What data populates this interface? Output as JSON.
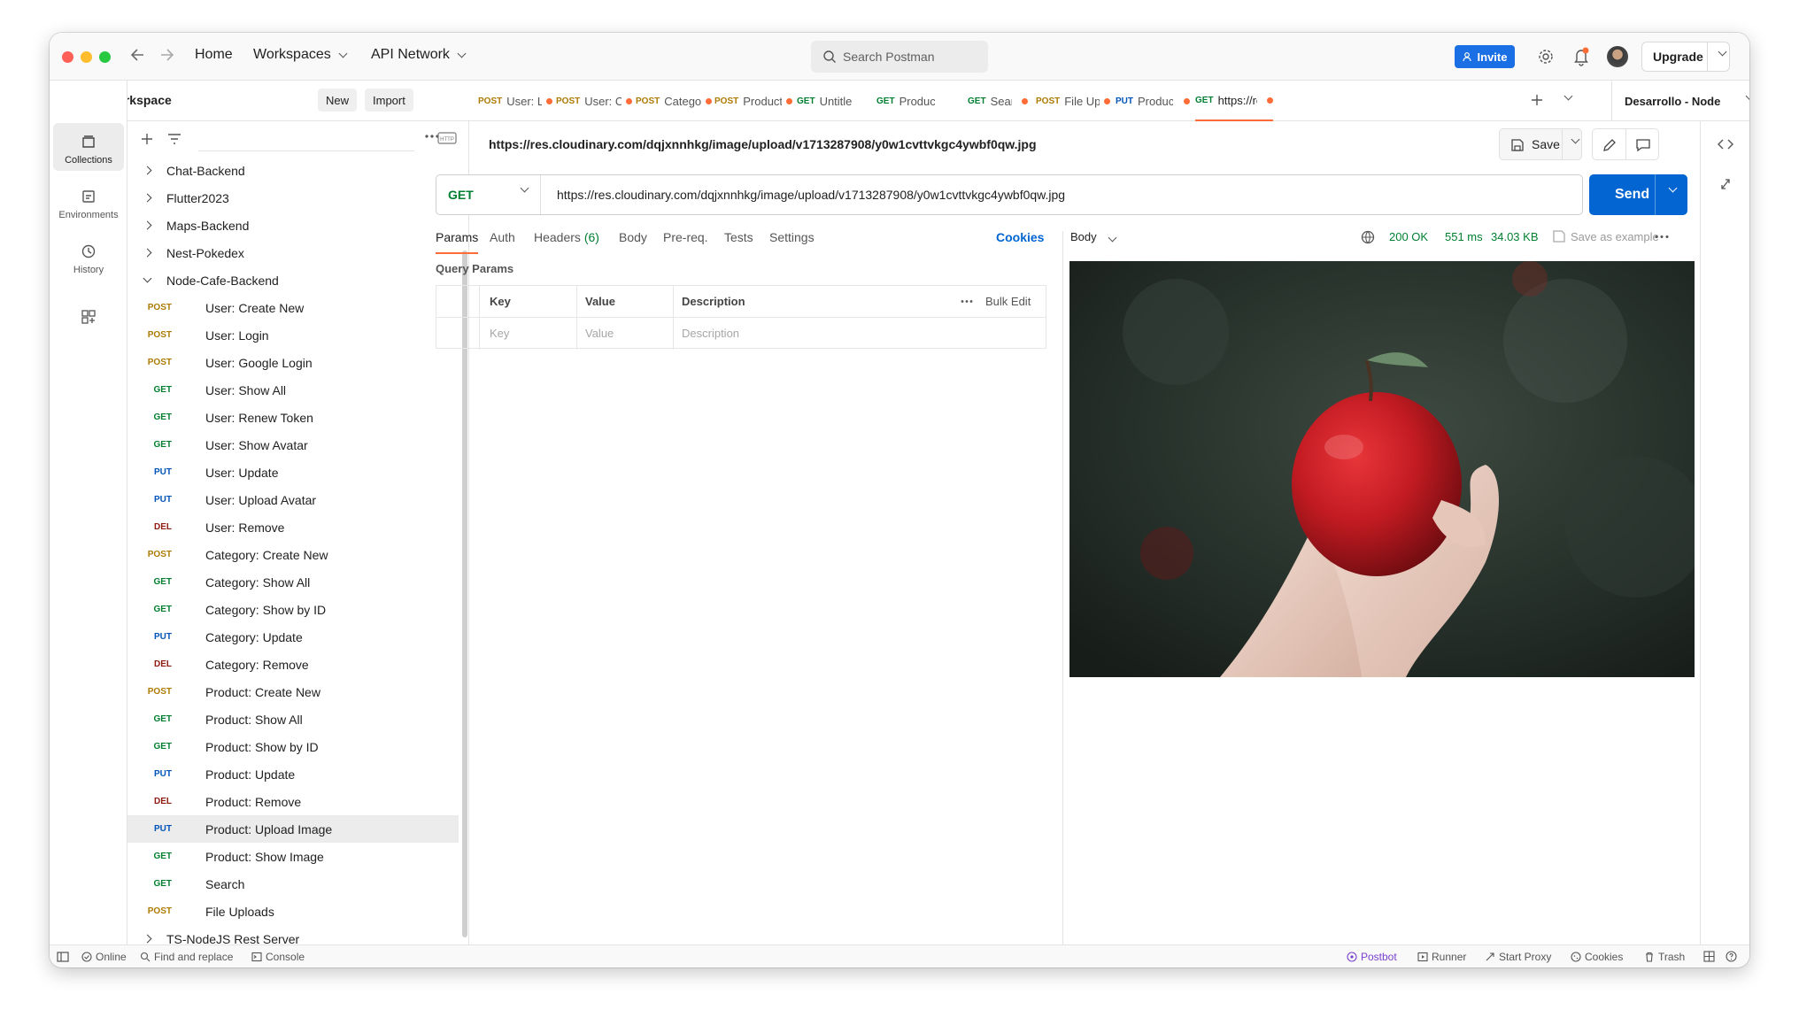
{
  "titlebar": {
    "nav": [
      "Home",
      "Workspaces",
      "API Network"
    ],
    "search_placeholder": "Search Postman",
    "invite_label": "Invite",
    "upgrade_label": "Upgrade"
  },
  "rail": [
    {
      "label": "Collections",
      "icon": "collections-icon",
      "active": true
    },
    {
      "label": "Environments",
      "icon": "environments-icon"
    },
    {
      "label": "History",
      "icon": "history-icon"
    }
  ],
  "sidebar": {
    "workspace_name": "My Workspace",
    "new_label": "New",
    "import_label": "Import",
    "collapsed_collections_top": [
      "Chat-Backend",
      "Flutter2023",
      "Maps-Backend",
      "Nest-Pokedex"
    ],
    "open_collection": "Node-Cafe-Backend",
    "requests": [
      {
        "method": "POST",
        "name": "User: Create New"
      },
      {
        "method": "POST",
        "name": "User: Login"
      },
      {
        "method": "POST",
        "name": "User: Google Login"
      },
      {
        "method": "GET",
        "name": "User: Show All"
      },
      {
        "method": "GET",
        "name": "User: Renew Token"
      },
      {
        "method": "GET",
        "name": "User: Show Avatar"
      },
      {
        "method": "PUT",
        "name": "User: Update"
      },
      {
        "method": "PUT",
        "name": "User: Upload Avatar"
      },
      {
        "method": "DEL",
        "name": "User: Remove"
      },
      {
        "method": "POST",
        "name": "Category: Create New"
      },
      {
        "method": "GET",
        "name": "Category: Show All"
      },
      {
        "method": "GET",
        "name": "Category: Show by ID"
      },
      {
        "method": "PUT",
        "name": "Category: Update"
      },
      {
        "method": "DEL",
        "name": "Category: Remove"
      },
      {
        "method": "POST",
        "name": "Product: Create New"
      },
      {
        "method": "GET",
        "name": "Product: Show All"
      },
      {
        "method": "GET",
        "name": "Product: Show by ID"
      },
      {
        "method": "PUT",
        "name": "Product: Update"
      },
      {
        "method": "DEL",
        "name": "Product: Remove"
      },
      {
        "method": "PUT",
        "name": "Product: Upload Image",
        "selected": true
      },
      {
        "method": "GET",
        "name": "Product: Show Image"
      },
      {
        "method": "GET",
        "name": "Search"
      },
      {
        "method": "POST",
        "name": "File Uploads"
      }
    ],
    "collapsed_collections_bottom": [
      "TS-NodeJS Rest Server"
    ]
  },
  "tabs": [
    {
      "method": "POST",
      "label": "User: Log",
      "dot": true
    },
    {
      "method": "POST",
      "label": "User: Cre",
      "dot": true
    },
    {
      "method": "POST",
      "label": "Category:",
      "dot": true
    },
    {
      "method": "POST",
      "label": "Product: (",
      "dot": true
    },
    {
      "method": "GET",
      "label": "Untitled Rec",
      "dot": false
    },
    {
      "method": "GET",
      "label": "Product: Sh",
      "dot": false
    },
    {
      "method": "GET",
      "label": "Search",
      "dot": true
    },
    {
      "method": "POST",
      "label": "File Uploa",
      "dot": true
    },
    {
      "method": "PUT",
      "label": "Product: U,",
      "dot": true
    },
    {
      "method": "GET",
      "label": "https://res.",
      "dot": true,
      "active": true
    }
  ],
  "environment": "Desarrollo - Node",
  "request": {
    "title": "https://res.cloudinary.com/dqjxnnhkg/image/upload/v1713287908/y0w1cvttvkgc4ywbf0qw.jpg",
    "method": "GET",
    "url": "https://res.cloudinary.com/dqjxnnhkg/image/upload/v1713287908/y0w1cvttvkgc4ywbf0qw.jpg",
    "save_label": "Save",
    "send_label": "Send",
    "tabs": [
      "Params",
      "Auth",
      "Headers",
      "Body",
      "Pre-req.",
      "Tests",
      "Settings"
    ],
    "headers_count": "(6)",
    "cookies_label": "Cookies",
    "query_params_label": "Query Params",
    "table_headers": [
      "Key",
      "Value",
      "Description"
    ],
    "bulk_edit_label": "Bulk Edit",
    "placeholders": [
      "Key",
      "Value",
      "Description"
    ]
  },
  "response": {
    "body_label": "Body",
    "status": "200 OK",
    "time": "551 ms",
    "size": "34.03 KB",
    "save_example_label": "Save as example"
  },
  "statusbar": {
    "online": "Online",
    "find_replace": "Find and replace",
    "console": "Console",
    "postbot": "Postbot",
    "runner": "Runner",
    "start_proxy": "Start Proxy",
    "cookies": "Cookies",
    "trash": "Trash"
  },
  "colors": {
    "accent": "#ff6c37",
    "send": "#0265d2",
    "invite": "#1b6fe4",
    "post": "#ad7a03",
    "get": "#007f31",
    "put": "#0053b8",
    "del": "#8e1a10",
    "postbot": "#7a3fd1"
  }
}
